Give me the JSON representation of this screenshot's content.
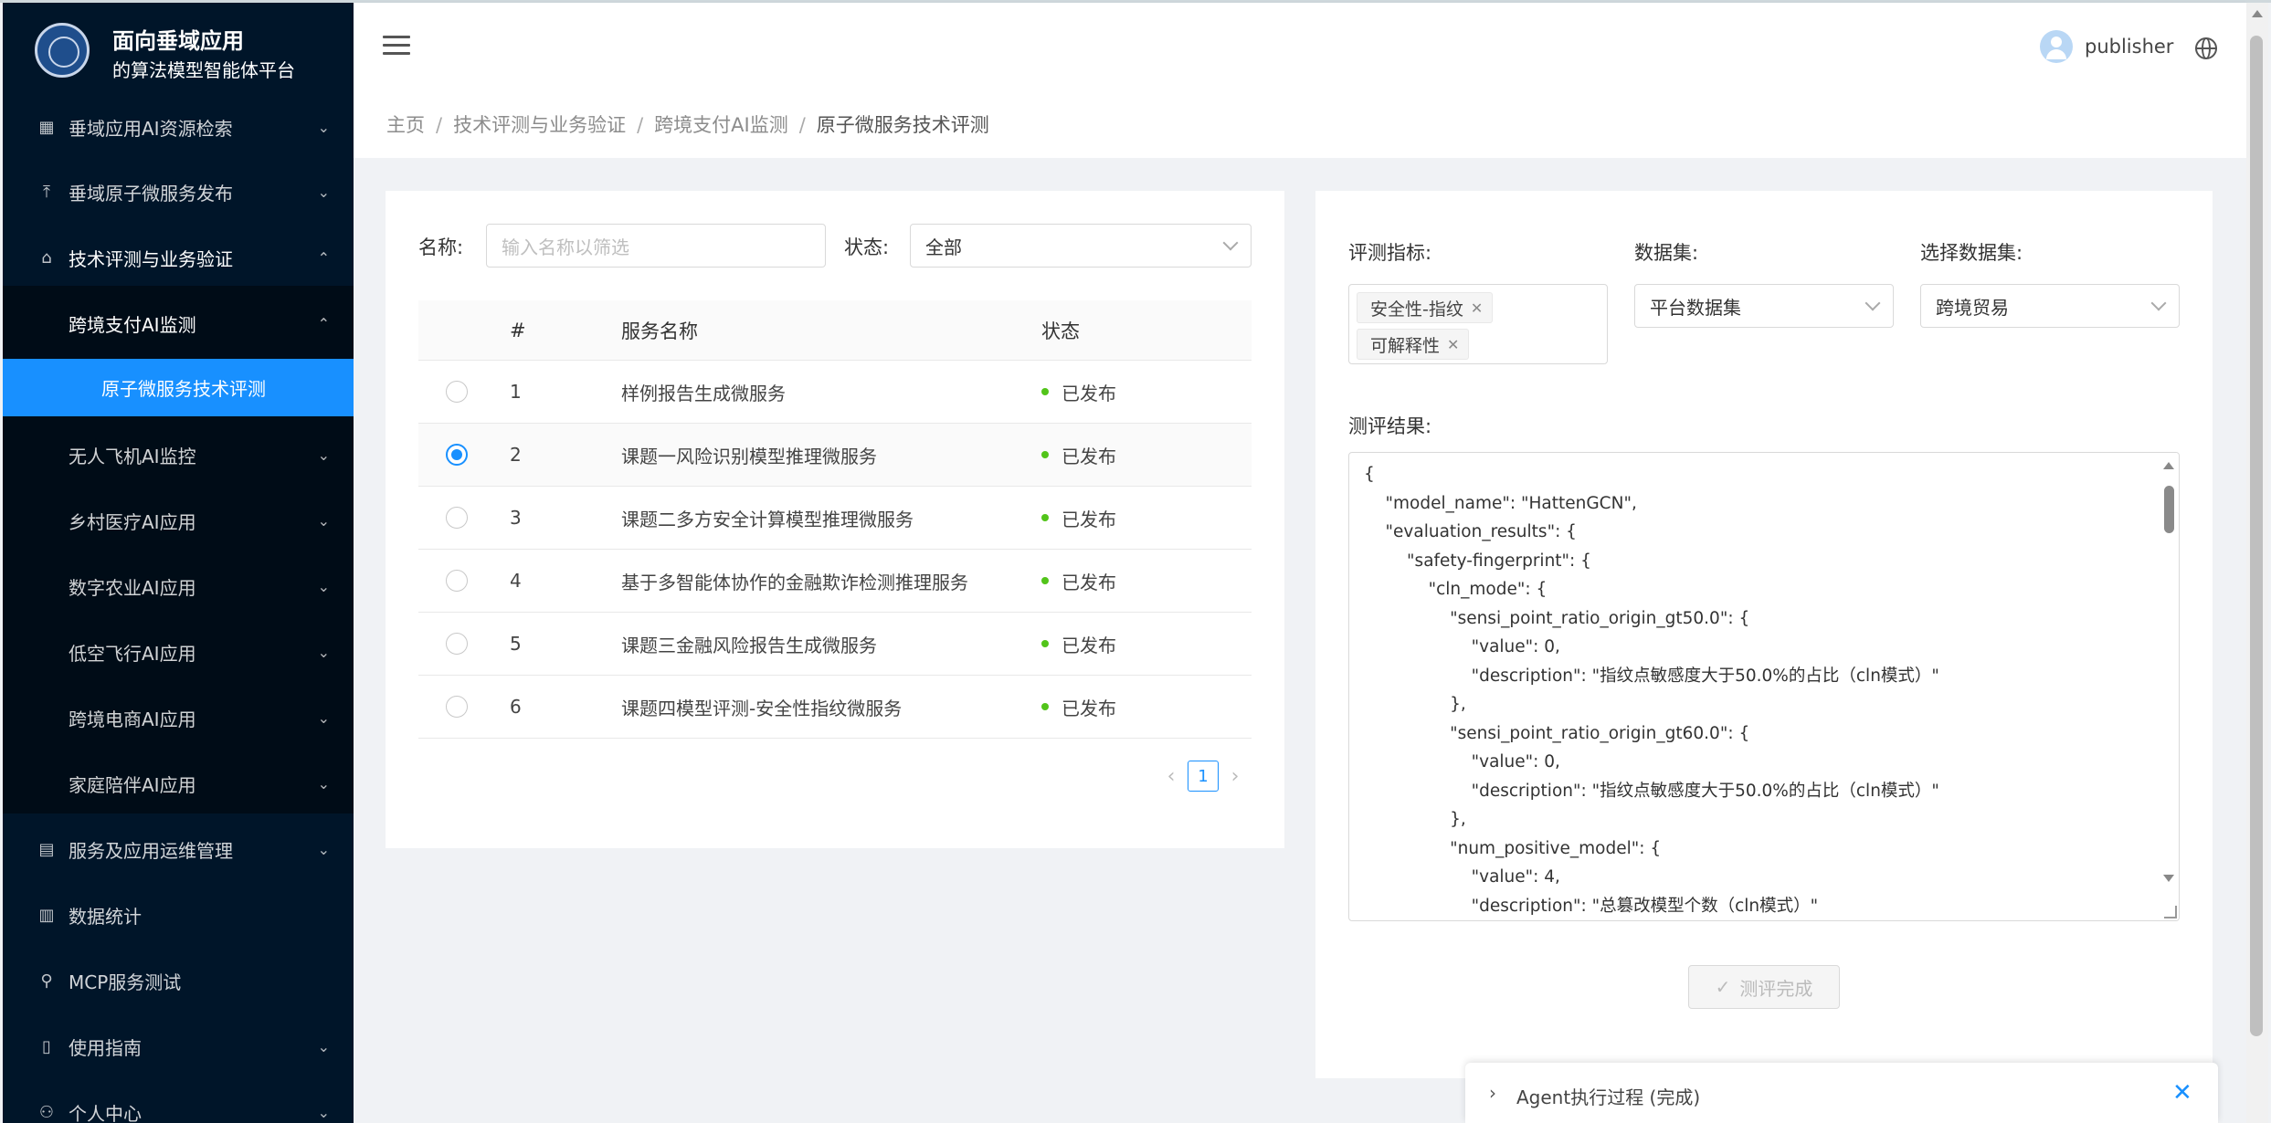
{
  "app": {
    "title_line1": "面向垂域应用",
    "title_line2": "的算法模型智能体平台"
  },
  "sidebar": {
    "items": [
      {
        "label": "垂域应用AI资源检索",
        "icon": "grid-icon"
      },
      {
        "label": "垂域原子微服务发布",
        "icon": "upload-icon"
      },
      {
        "label": "技术评测与业务验证",
        "icon": "bank-icon"
      },
      {
        "label": "跨境支付AI监测",
        "icon": ""
      },
      {
        "label": "原子微服务技术评测",
        "icon": ""
      },
      {
        "label": "无人飞机AI监控",
        "icon": ""
      },
      {
        "label": "乡村医疗AI应用",
        "icon": ""
      },
      {
        "label": "数字农业AI应用",
        "icon": ""
      },
      {
        "label": "低空飞行AI应用",
        "icon": ""
      },
      {
        "label": "跨境电商AI应用",
        "icon": ""
      },
      {
        "label": "家庭陪伴AI应用",
        "icon": ""
      },
      {
        "label": "服务及应用运维管理",
        "icon": "control-icon"
      },
      {
        "label": "数据统计",
        "icon": "bar-chart-icon"
      },
      {
        "label": "MCP服务测试",
        "icon": "api-icon"
      },
      {
        "label": "使用指南",
        "icon": "book-icon"
      },
      {
        "label": "个人中心",
        "icon": "user-icon"
      }
    ]
  },
  "header": {
    "username": "publisher"
  },
  "breadcrumb": {
    "items": [
      "主页",
      "技术评测与业务验证",
      "跨境支付AI监测",
      "原子微服务技术评测"
    ]
  },
  "filters": {
    "name_label": "名称:",
    "name_placeholder": "输入名称以筛选",
    "status_label": "状态:",
    "status_value": "全部"
  },
  "table": {
    "columns": [
      "#",
      "服务名称",
      "状态"
    ],
    "rows": [
      {
        "num": "1",
        "name": "样例报告生成微服务",
        "status": "已发布",
        "selected": false
      },
      {
        "num": "2",
        "name": "课题一风险识别模型推理微服务",
        "status": "已发布",
        "selected": true
      },
      {
        "num": "3",
        "name": "课题二多方安全计算模型推理微服务",
        "status": "已发布",
        "selected": false
      },
      {
        "num": "4",
        "name": "基于多智能体协作的金融欺诈检测推理服务",
        "status": "已发布",
        "selected": false
      },
      {
        "num": "5",
        "name": "课题三金融风险报告生成微服务",
        "status": "已发布",
        "selected": false
      },
      {
        "num": "6",
        "name": "课题四模型评测-安全性指纹微服务",
        "status": "已发布",
        "selected": false
      }
    ]
  },
  "pagination": {
    "current_page": "1"
  },
  "evaluation": {
    "metric_label": "评测指标:",
    "metric_tags": [
      "安全性-指纹",
      "可解释性"
    ],
    "dataset_label": "数据集:",
    "dataset_value": "平台数据集",
    "choose_dataset_label": "选择数据集:",
    "choose_dataset_value": "跨境贸易",
    "result_label": "测评结果:",
    "result_lines": [
      "{",
      "    \"model_name\": \"HattenGCN\",",
      "    \"evaluation_results\": {",
      "        \"safety-fingerprint\": {",
      "            \"cln_mode\": {",
      "                \"sensi_point_ratio_origin_gt50.0\": {",
      "                    \"value\": 0,",
      "                    \"description\": \"指纹点敏感度大于50.0%的占比（cln模式）\"",
      "                },",
      "                \"sensi_point_ratio_origin_gt60.0\": {",
      "                    \"value\": 0,",
      "                    \"description\": \"指纹点敏感度大于50.0%的占比（cln模式）\"",
      "                },",
      "                \"num_positive_model\": {",
      "                    \"value\": 4,",
      "                    \"description\": \"总篡改模型个数（cln模式）\""
    ],
    "done_button": "测评完成"
  },
  "agent_panel": {
    "title": "Agent执行过程 (完成)"
  },
  "colors": {
    "sidebar_bg": "#001529",
    "accent": "#1890ff",
    "status_green": "#52c41a"
  }
}
